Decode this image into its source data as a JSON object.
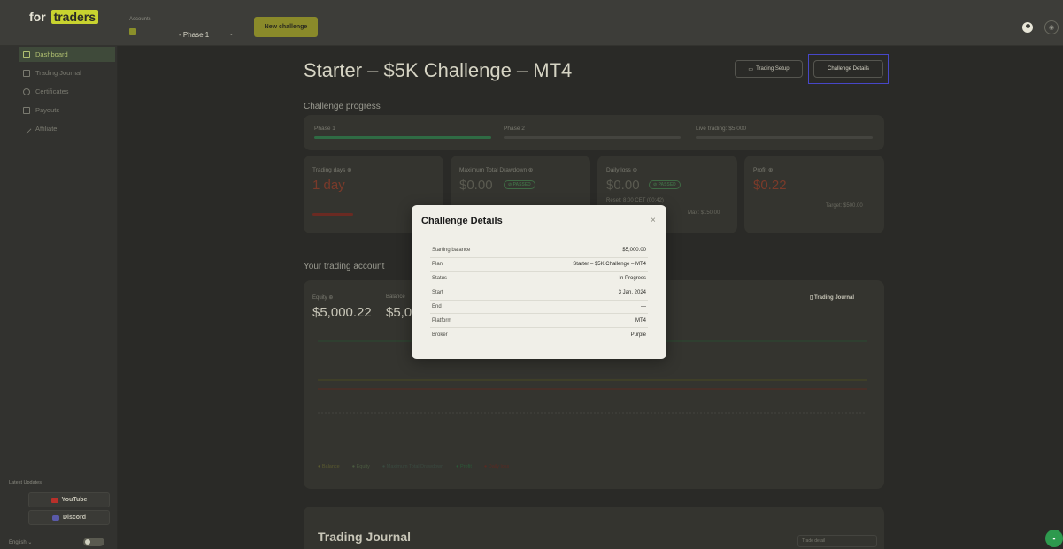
{
  "topbar": {
    "logo_prefix": "for",
    "logo_box": "traders",
    "accounts_label": "Accounts",
    "phase": "- Phase 1",
    "new_challenge": "New challenge"
  },
  "sidebar": {
    "items": [
      {
        "label": "Dashboard",
        "icon": "grid-icon"
      },
      {
        "label": "Trading Journal",
        "icon": "book-icon"
      },
      {
        "label": "Certificates",
        "icon": "certificate-icon"
      },
      {
        "label": "Payouts",
        "icon": "payout-icon"
      },
      {
        "label": "Affiliate",
        "icon": "link-icon"
      }
    ],
    "updates_label": "Latest Updates",
    "youtube": "YouTube",
    "discord": "Discord",
    "language": "English ⌄"
  },
  "main": {
    "title": "Starter – $5K Challenge – MT4",
    "trading_setup": "Trading Setup",
    "challenge_details": "Challenge Details",
    "challenge_progress": "Challenge progress",
    "phases": [
      "Phase 1",
      "Phase 2",
      "Live trading: $5,000"
    ],
    "stats": {
      "trading_days_label": "Trading days ⊕",
      "trading_days_value": "1 day",
      "max_drawdown_label": "Maximum Total Drawdown ⊕",
      "max_drawdown_value": "$0.00",
      "daily_loss_label": "Daily loss ⊕",
      "daily_loss_value": "$0.00",
      "profit_label": "Profit ⊕",
      "profit_value": "$0.22",
      "passed": "⊘ PASSED",
      "daily_reset": "Reset: 8:00 CET (00:42)",
      "max": "Max: $150.00",
      "target": "Target: $500.00"
    },
    "your_trading_account": "Your trading account",
    "equity_label": "Equity ⊕",
    "equity_value": "$5,000.22",
    "balance_label": "Balance",
    "balance_value": "$5,0",
    "trading_journal_link": "Trading Journal",
    "legend": [
      "Balance",
      "Equity",
      "Maximum Total Drawdown",
      "Profit",
      "Daily loss"
    ],
    "journal_title": "Trading Journal",
    "journal_field": "Trade detail"
  },
  "modal": {
    "title": "Challenge Details",
    "close": "×",
    "rows": [
      {
        "label": "Starting balance",
        "value": "$5,000.00"
      },
      {
        "label": "Plan",
        "value": "Starter – $5K Challenge – MT4"
      },
      {
        "label": "Status",
        "value": "In Progress"
      },
      {
        "label": "Start",
        "value": "3 Jan, 2024"
      },
      {
        "label": "End",
        "value": "—"
      },
      {
        "label": "Platform",
        "value": "MT4"
      },
      {
        "label": "Broker",
        "value": "Purple"
      }
    ]
  }
}
